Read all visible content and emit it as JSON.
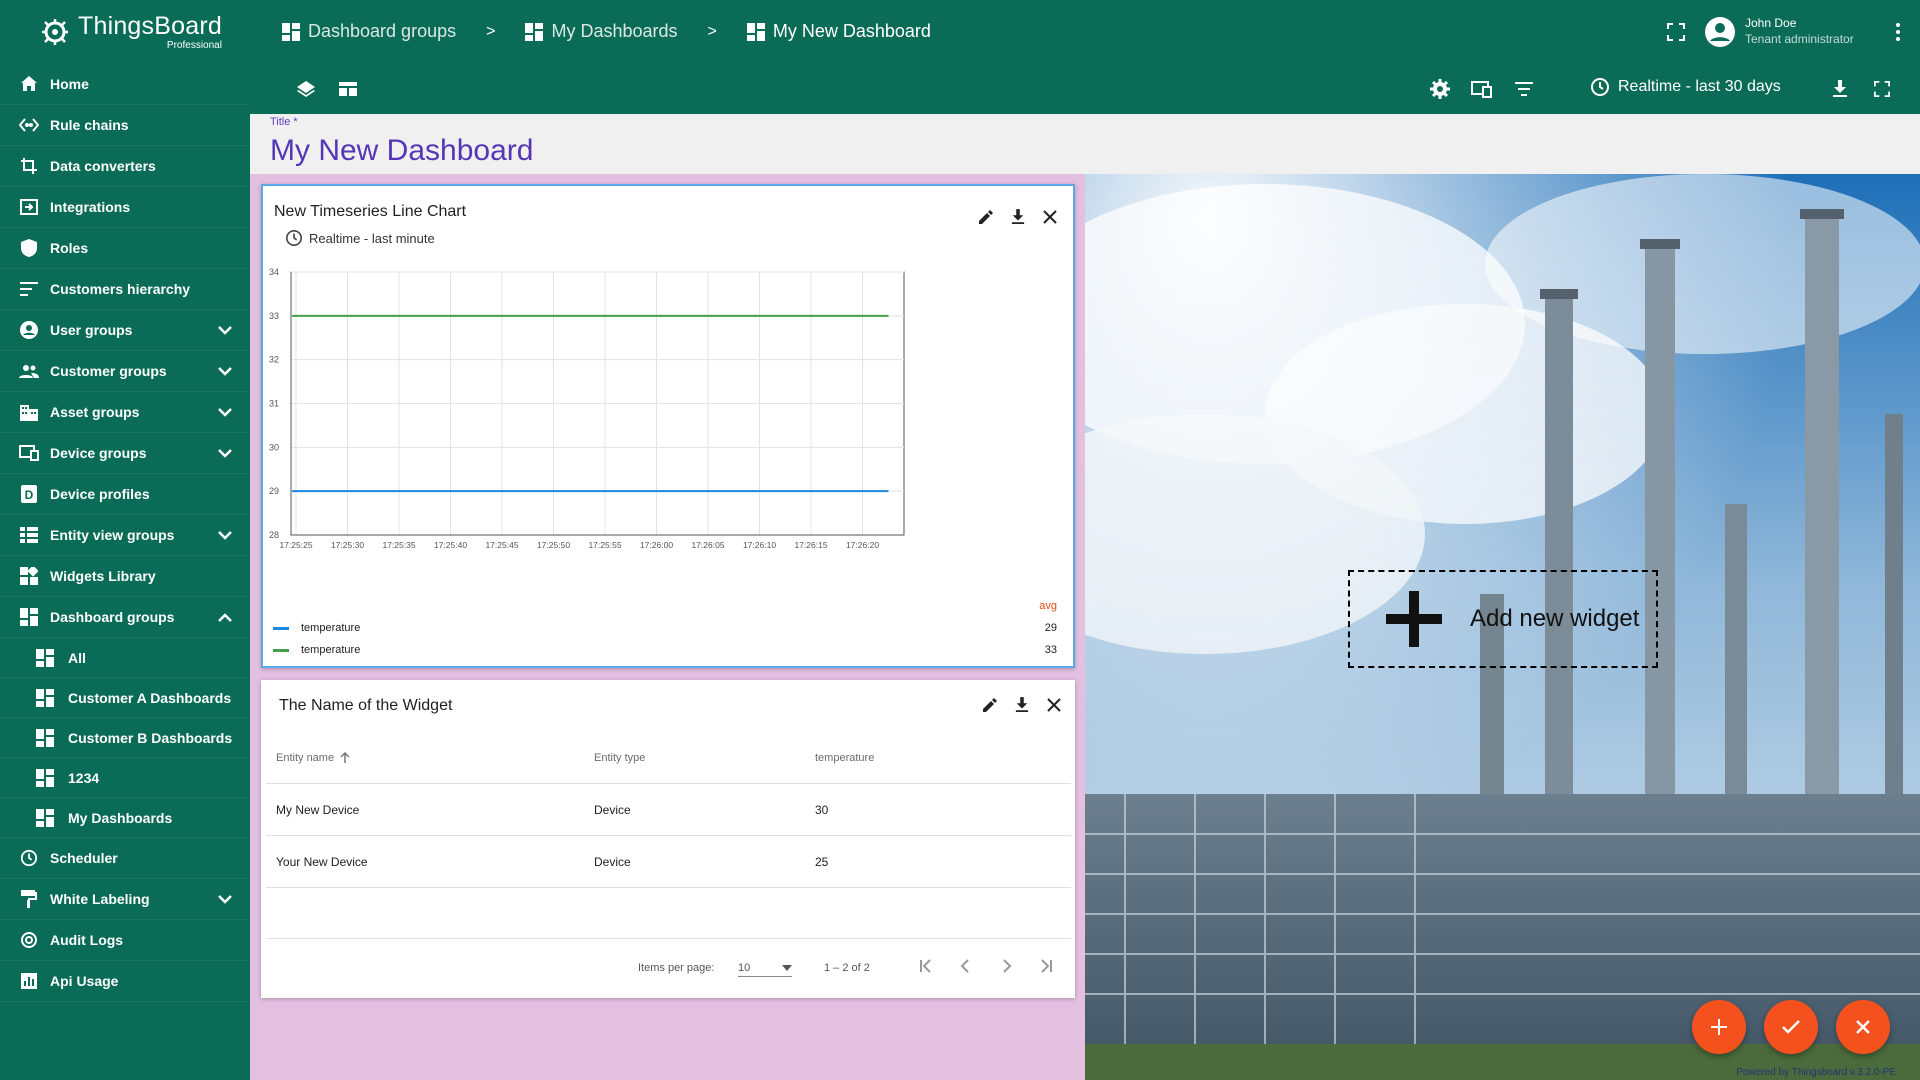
{
  "app": {
    "logo_name": "ThingsBoard",
    "logo_sub": "Professional"
  },
  "sidebar": {
    "items": [
      {
        "label": "Home",
        "icon": "home-icon"
      },
      {
        "label": "Rule chains",
        "icon": "rule-chains-icon"
      },
      {
        "label": "Data converters",
        "icon": "converters-icon"
      },
      {
        "label": "Integrations",
        "icon": "integrations-icon"
      },
      {
        "label": "Roles",
        "icon": "roles-icon"
      },
      {
        "label": "Customers hierarchy",
        "icon": "hierarchy-icon"
      },
      {
        "label": "User groups",
        "icon": "user-icon",
        "expandable": true
      },
      {
        "label": "Customer groups",
        "icon": "customer-icon",
        "expandable": true
      },
      {
        "label": "Asset groups",
        "icon": "asset-icon",
        "expandable": true
      },
      {
        "label": "Device groups",
        "icon": "device-icon",
        "expandable": true
      },
      {
        "label": "Device profiles",
        "icon": "device-profile-icon"
      },
      {
        "label": "Entity view groups",
        "icon": "entity-view-icon",
        "expandable": true
      },
      {
        "label": "Widgets Library",
        "icon": "widgets-icon"
      },
      {
        "label": "Dashboard groups",
        "icon": "dashboard-icon",
        "expanded": true
      },
      {
        "label": "All",
        "icon": "dashboard-icon"
      },
      {
        "label": "Customer A Dashboards",
        "icon": "dashboard-icon"
      },
      {
        "label": "Customer B Dashboards",
        "icon": "dashboard-icon"
      },
      {
        "label": "1234",
        "icon": "dashboard-icon"
      },
      {
        "label": "My Dashboards",
        "icon": "dashboard-icon"
      },
      {
        "label": "Scheduler",
        "icon": "clock-icon"
      },
      {
        "label": "White Labeling",
        "icon": "paint-icon",
        "expandable": true
      },
      {
        "label": "Audit Logs",
        "icon": "audit-icon"
      },
      {
        "label": "Api Usage",
        "icon": "chart-icon"
      }
    ]
  },
  "header": {
    "breadcrumb": [
      "Dashboard groups",
      "My Dashboards",
      "My New Dashboard"
    ],
    "user_name": "John Doe",
    "user_role": "Tenant administrator",
    "timewindow": "Realtime - last 30 days"
  },
  "title_field": {
    "label": "Title *",
    "value": "My New Dashboard"
  },
  "chart_widget": {
    "title": "New Timeseries Line Chart",
    "timewindow": "Realtime - last minute",
    "legend_header": "avg",
    "legend": [
      {
        "name": "temperature",
        "value": "29"
      },
      {
        "name": "temperature",
        "value": "33"
      }
    ]
  },
  "chart_data": {
    "type": "line",
    "title": "New Timeseries Line Chart",
    "x_ticks": [
      "17:25:25",
      "17:25:30",
      "17:25:35",
      "17:25:40",
      "17:25:45",
      "17:25:50",
      "17:25:55",
      "17:26:00",
      "17:26:05",
      "17:26:10",
      "17:26:15",
      "17:26:20"
    ],
    "y_ticks": [
      "34",
      "33",
      "32",
      "31",
      "30",
      "29",
      "28"
    ],
    "ylim": [
      28,
      34
    ],
    "grid": true,
    "series": [
      {
        "name": "temperature",
        "color": "#1e88e5",
        "x": [
          "17:25:25",
          "17:26:20"
        ],
        "values": [
          29,
          29
        ]
      },
      {
        "name": "temperature",
        "color": "#43a047",
        "x": [
          "17:25:25",
          "17:26:20"
        ],
        "values": [
          33,
          33
        ]
      }
    ]
  },
  "table_widget": {
    "title": "The Name of the Widget",
    "columns": [
      "Entity name",
      "Entity type",
      "temperature"
    ],
    "rows": [
      [
        "My New Device",
        "Device",
        "30"
      ],
      [
        "Your New Device",
        "Device",
        "25"
      ]
    ],
    "items_per_page_label": "Items per page:",
    "items_per_page_value": "10",
    "range_label": "1 – 2 of 2"
  },
  "add_widget": {
    "label": "Add new widget"
  },
  "footer": {
    "powered": "Powered by Thingsboard v.3.2.0-PE"
  },
  "colors": {
    "primary": "#0a6b56",
    "accent": "#f4511e",
    "title": "#5636b7",
    "dash_bg": "#e3bfe0"
  }
}
